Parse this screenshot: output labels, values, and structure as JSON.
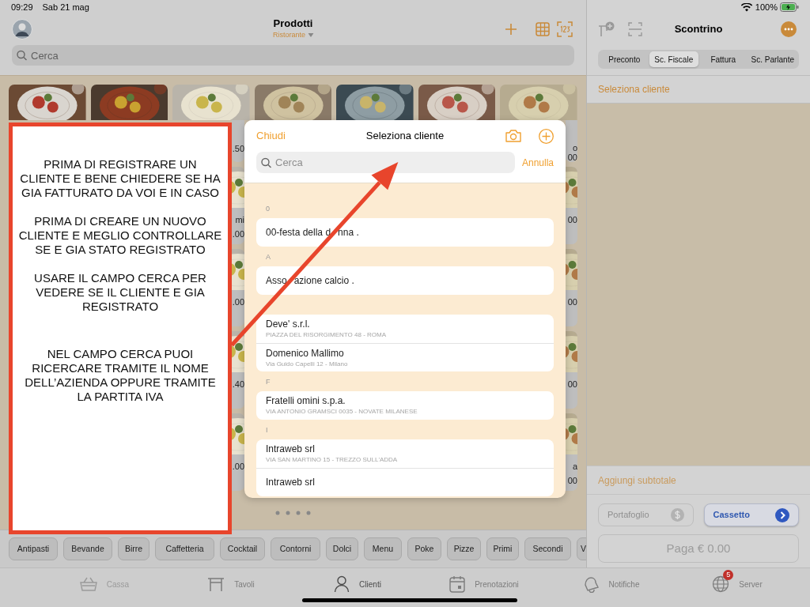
{
  "status_bar": {
    "time": "09:29",
    "date": "Sab 21 mag",
    "battery": "100%"
  },
  "products_header": {
    "title": "Prodotti",
    "subtitle": "Ristorante",
    "search": {
      "placeholder": "Cerca"
    }
  },
  "product_cards": [
    {
      "kind": "picture"
    },
    {
      "kind": "picture"
    },
    {
      "kind": "picture",
      "price": ".50"
    },
    {
      "kind": "picture"
    },
    {
      "kind": "picture"
    },
    {
      "kind": "picture"
    },
    {
      "kind": "picture",
      "name": "o",
      "price": "00"
    },
    {
      "kind": "picture",
      "name": "mi",
      "price": ".00"
    },
    {
      "kind": "picture",
      "price": "00"
    },
    {
      "kind": "picture",
      "price": ".00"
    },
    {
      "kind": "picture",
      "price": "00"
    },
    {
      "kind": "picture",
      "price": ".40"
    },
    {
      "kind": "picture",
      "price": "00"
    },
    {
      "kind": "picture",
      "price": ".00"
    },
    {
      "kind": "picture",
      "name": "a",
      "price": "00"
    }
  ],
  "categories": [
    "Antipasti",
    "Bevande",
    "Birre",
    "Caffetteria",
    "Cocktail",
    "Contorni",
    "Dolci",
    "Menu",
    "Poke",
    "Pizze",
    "Primi",
    "Secondi",
    "V"
  ],
  "receipt": {
    "title": "Scontrino",
    "tabs": [
      {
        "label": "Preconto",
        "selected": false
      },
      {
        "label": "Sc. Fiscale",
        "selected": true
      },
      {
        "label": "Fattura",
        "selected": false
      },
      {
        "label": "Sc. Parlante",
        "selected": false
      }
    ],
    "customer_link": "Seleziona cliente",
    "subtotal_link": "Aggiungi subtotale",
    "buttons": [
      {
        "kind": "wallet",
        "label": "Portafoglio",
        "disabled": true
      },
      {
        "kind": "drawer",
        "label": "Cassetto",
        "disabled": false
      }
    ],
    "pay_button": "Paga € 0.00"
  },
  "tab_bar": [
    {
      "kind": "basket",
      "label": "Cassa",
      "selected": false,
      "disabled": true
    },
    {
      "kind": "table",
      "label": "Tavoli",
      "selected": false,
      "disabled": false
    },
    {
      "kind": "person",
      "label": "Clienti",
      "selected": true,
      "disabled": false
    },
    {
      "kind": "calendar",
      "label": "Prenotazioni",
      "selected": false,
      "disabled": false
    },
    {
      "kind": "bell",
      "label": "Notifiche",
      "selected": false,
      "disabled": false
    },
    {
      "kind": "globe",
      "label": "Server",
      "selected": false,
      "disabled": false,
      "badge": "5"
    }
  ],
  "client_picker": {
    "close": "Chiudi",
    "title": "Seleziona cliente",
    "search": {
      "placeholder": "Cerca"
    },
    "cancel": "Annulla",
    "sections": [
      {
        "header": "0",
        "clients": [
          {
            "name_parts": [
              "00-festa della d",
              "nna ."
            ]
          }
        ]
      },
      {
        "header": "A",
        "clients": [
          {
            "name_parts": [
              "Asso",
              "azione calcio ."
            ]
          }
        ]
      },
      {
        "clients": [
          {
            "name": "Deve' s.r.l.",
            "address": "PIAZZA DEL RISORGIMENTO 48  - ROMA"
          },
          {
            "name": "Domenico Mallimo",
            "address": "Via Guido Capelli 12 - Milano"
          }
        ]
      },
      {
        "header": "F",
        "clients": [
          {
            "name": "Fratelli omini s.p.a.",
            "address": "VIA ANTONIO GRAMSCI 0035  - NOVATE MILANESE"
          }
        ]
      },
      {
        "header": "I",
        "clients": [
          {
            "name": "Intraweb srl",
            "address": "VIA SAN MARTINO 15  - TREZZO SULL'ADDA"
          },
          {
            "name": "Intraweb srl"
          }
        ]
      }
    ]
  },
  "note": {
    "paragraphs": [
      "PRIMA DI REGISTRARE UN CLIENTE E BENE CHIEDERE SE HA GIA FATTURATO DA VOI E IN CASO",
      "PRIMA DI CREARE UN NUOVO CLIENTE E MEGLIO CONTROLLARE SE E GIA STATO REGISTRATO",
      "USARE IL CAMPO CERCA PER VEDERE SE IL CLIENTE E GIA REGISTRATO",
      "NEL CAMPO CERCA PUOI RICERCARE TRAMITE IL NOME DELL’AZIENDA OPPURE TRAMITE LA PARTITA IVA"
    ]
  }
}
